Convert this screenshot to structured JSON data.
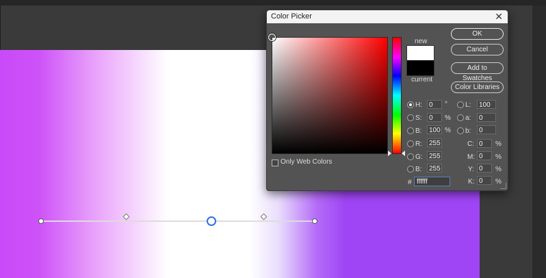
{
  "dialog": {
    "title": "Color Picker",
    "close_glyph": "✕",
    "new_label": "new",
    "current_label": "current",
    "buttons": {
      "ok": "OK",
      "cancel": "Cancel",
      "add_to_swatches": "Add to Swatches",
      "color_libraries": "Color Libraries"
    },
    "only_web_colors_label": "Only Web Colors",
    "selected_mode": "H",
    "hsb": [
      {
        "label": "H:",
        "value": "0",
        "unit": "°"
      },
      {
        "label": "S:",
        "value": "0",
        "unit": "%"
      },
      {
        "label": "B:",
        "value": "100",
        "unit": "%"
      }
    ],
    "rgb": [
      {
        "label": "R:",
        "value": "255"
      },
      {
        "label": "G:",
        "value": "255"
      },
      {
        "label": "B:",
        "value": "255"
      }
    ],
    "lab": [
      {
        "label": "L:",
        "value": "100"
      },
      {
        "label": "a:",
        "value": "0"
      },
      {
        "label": "b:",
        "value": "0"
      }
    ],
    "cmyk": [
      {
        "label": "C:",
        "value": "0",
        "unit": "%"
      },
      {
        "label": "M:",
        "value": "0",
        "unit": "%"
      },
      {
        "label": "Y:",
        "value": "0",
        "unit": "%"
      },
      {
        "label": "K:",
        "value": "0",
        "unit": "%"
      }
    ],
    "hex_label": "#",
    "hex_value": "ffffff",
    "new_color": "#ffffff",
    "current_color": "#000000"
  },
  "canvas": {
    "gradient_colors": [
      "#c94af8",
      "#ffffff",
      "#9f45f5"
    ]
  }
}
